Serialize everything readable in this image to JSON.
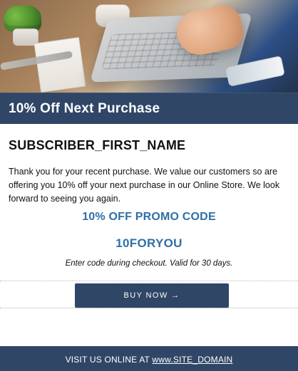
{
  "email": {
    "header": {
      "title": "10% Off Next Purchase"
    },
    "subscriber": {
      "name": "SUBSCRIBER_FIRST_NAME"
    },
    "message": "Thank you for your recent purchase. We value our customers so are offering you 10% off your next purchase in our Online Store.  We look forward to seeing you again.",
    "promo": {
      "label": "10% OFF PROMO CODE",
      "code": "10FORYOU",
      "note": "Enter code during checkout. Valid for 30 days."
    },
    "cta": {
      "label": "BUY NOW →"
    },
    "footer": {
      "prefix": "VISIT US ONLINE AT ",
      "link_text": "www.SITE_DOMAIN"
    }
  },
  "colors": {
    "title_bar_bg": "#2f4666",
    "accent_text": "#2f6fa7",
    "page_bg": "#ffffff"
  },
  "icons": {
    "cta_arrow": "right-arrow-icon"
  }
}
